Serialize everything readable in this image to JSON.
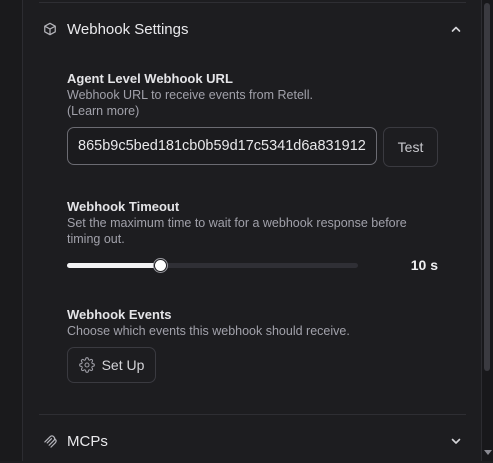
{
  "webhook_settings": {
    "section_title": "Webhook Settings",
    "agent_url": {
      "label": "Agent Level Webhook URL",
      "help": "Webhook URL to receive events from Retell.",
      "learn_more": "(Learn more)",
      "value": "865b9c5bed181cb0b59d17c5341d6a831912",
      "test_label": "Test"
    },
    "timeout": {
      "label": "Webhook Timeout",
      "help": "Set the maximum time to wait for a webhook response before timing out.",
      "value_text": "10 s",
      "fraction": 0.32
    },
    "events": {
      "label": "Webhook Events",
      "help": "Choose which events this webhook should receive.",
      "setup_label": "Set Up"
    }
  },
  "mcps": {
    "section_title": "MCPs"
  },
  "icons": {
    "webhook_section": "cube-icon",
    "webhook_toggle": "chevron-up-icon",
    "mcps_section": "mcp-icon",
    "mcps_toggle": "chevron-down-icon",
    "setup": "gear-icon"
  }
}
